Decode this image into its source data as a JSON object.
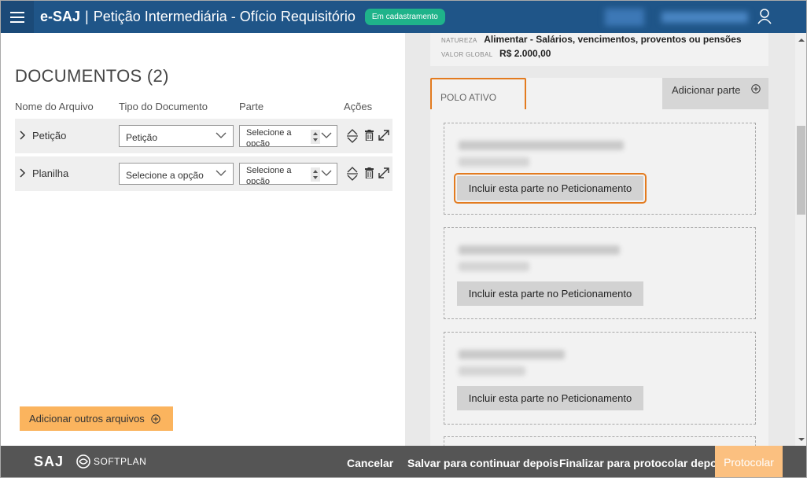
{
  "header": {
    "brand": "e-SAJ",
    "separator": "|",
    "title": "Petição Intermediária - Ofício Requisitório",
    "status_badge": "Em cadastramento",
    "accent_color": "#1f5588",
    "icons": [
      "menu-icon",
      "user-icon"
    ]
  },
  "documents": {
    "title": "DOCUMENTOS (2)",
    "columns": [
      "Nome do Arquivo",
      "Tipo do Documento",
      "Parte",
      "Ações"
    ],
    "rows": [
      {
        "name": "Petição",
        "tipo": "Petição",
        "parte": "Selecione a opção"
      },
      {
        "name": "Planilha",
        "tipo": "Selecione a opção",
        "parte": "Selecione a opção"
      }
    ],
    "add_files_label": "Adicionar outros arquivos"
  },
  "info": {
    "natureza_label": "NATUREZA",
    "natureza_value": "Alimentar - Salários, vencimentos, proventos ou pensões",
    "valor_label": "VALOR GLOBAL",
    "valor_value": "R$ 2.000,00"
  },
  "polo": {
    "tab_label": "POLO ATIVO",
    "add_parte_label": "Adicionar parte",
    "include_label": "Incluir esta parte no Peticionamento"
  },
  "footer": {
    "logo": "SAJ",
    "softplan": "SOFTPLAN",
    "cancelar": "Cancelar",
    "salvar": "Salvar para continuar depois",
    "finalizar": "Finalizar para protocolar depois",
    "protocolar": "Protocolar",
    "protocolar_color": "#fbc080"
  }
}
